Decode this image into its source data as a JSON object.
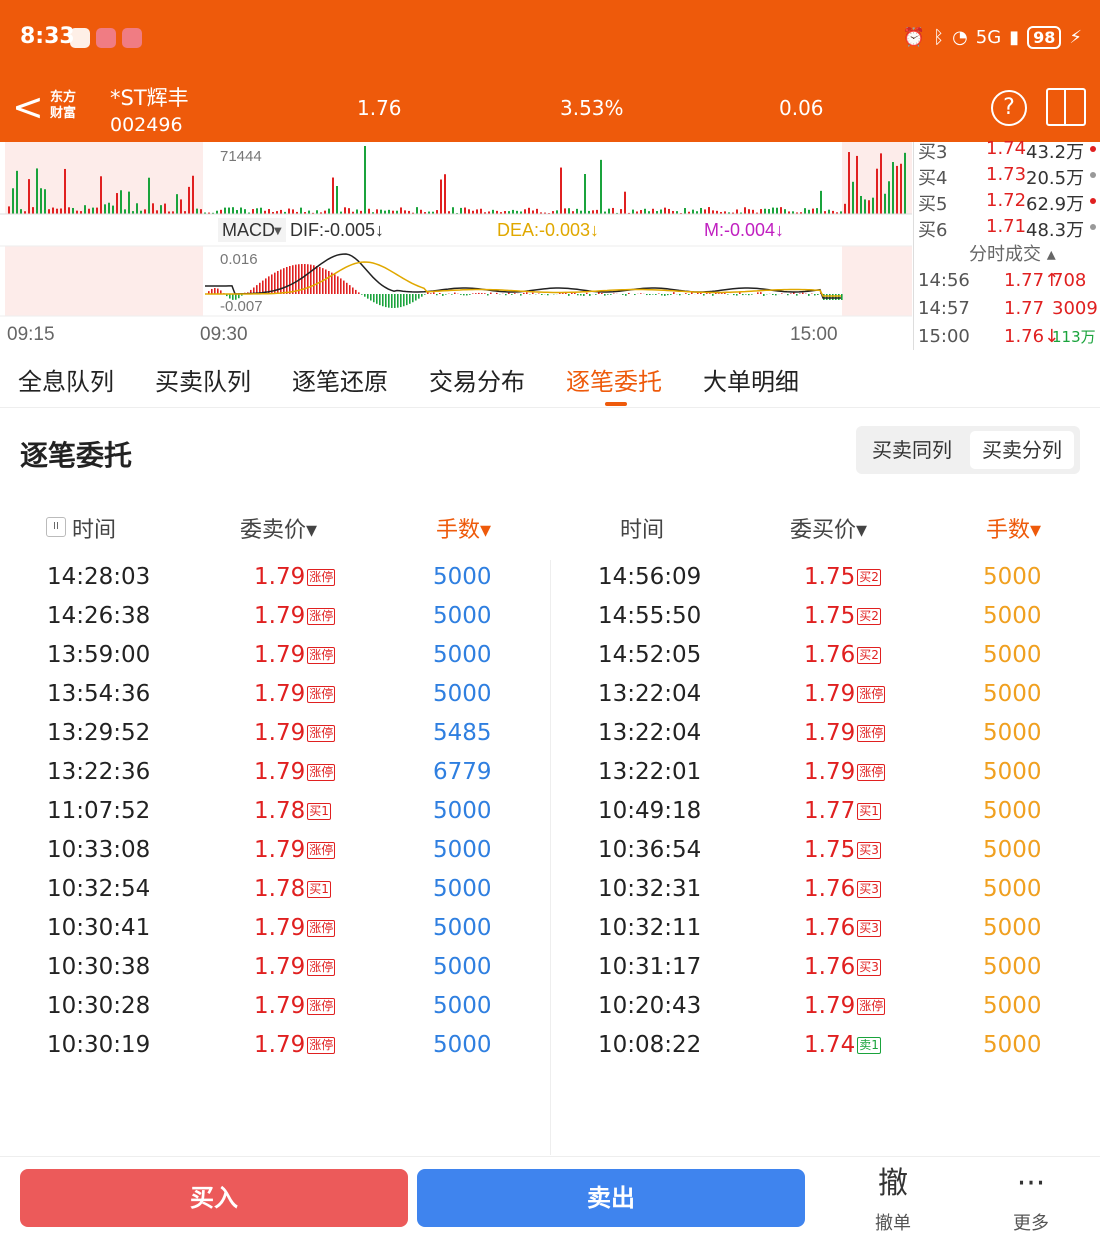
{
  "status": {
    "time": "8:33",
    "battery": "98",
    "signal": "5G"
  },
  "header": {
    "back": "<",
    "logo_line1": "东方",
    "logo_line2": "财富",
    "name": "*ST辉丰",
    "code": "002496",
    "price": "1.76",
    "pct": "3.53%",
    "change": "0.06",
    "help": "?"
  },
  "chart": {
    "volume_label": "71444",
    "macd_label": "MACD",
    "dif": "DIF:-0.005↓",
    "dea": "DEA:-0.003↓",
    "m": "M:-0.004↓",
    "macd_top": "0.016",
    "macd_bottom": "-0.007",
    "time_start": "09:15",
    "time_open": "09:30",
    "time_end": "15:00"
  },
  "orderbook": {
    "bids": [
      {
        "label": "买3",
        "price": "1.74",
        "vol": "43.2万",
        "dot": "#e02020"
      },
      {
        "label": "买4",
        "price": "1.73",
        "vol": "20.5万",
        "dot": "#999999"
      },
      {
        "label": "买5",
        "price": "1.72",
        "vol": "62.9万",
        "dot": "#e02020"
      },
      {
        "label": "买6",
        "price": "1.71",
        "vol": "48.3万",
        "dot": "#999999"
      }
    ],
    "trades_title": "分时成交",
    "trades": [
      {
        "time": "14:56",
        "price": "1.77↑",
        "vol": "708",
        "vol_color": "#e02020"
      },
      {
        "time": "14:57",
        "price": "1.77",
        "vol": "3009",
        "vol_color": "#e02020"
      },
      {
        "time": "15:00",
        "price": "1.76↓",
        "vol": "113万",
        "vol_color": "#1aa33c"
      }
    ]
  },
  "tabs": [
    {
      "label": "全息队列"
    },
    {
      "label": "买卖队列"
    },
    {
      "label": "逐笔还原"
    },
    {
      "label": "交易分布"
    },
    {
      "label": "逐笔委托"
    },
    {
      "label": "大单明细"
    }
  ],
  "section": {
    "title": "逐笔委托",
    "toggle_a": "买卖同列",
    "toggle_b": "买卖分列"
  },
  "columns": {
    "time": "时间",
    "sell_price": "委卖价▾",
    "qty": "手数▾",
    "time2": "时间",
    "buy_price": "委买价▾",
    "qty2": "手数▾"
  },
  "sell_orders": [
    {
      "time": "14:28:03",
      "price": "1.79",
      "tag": "涨停",
      "vol": "5000"
    },
    {
      "time": "14:26:38",
      "price": "1.79",
      "tag": "涨停",
      "vol": "5000"
    },
    {
      "time": "13:59:00",
      "price": "1.79",
      "tag": "涨停",
      "vol": "5000"
    },
    {
      "time": "13:54:36",
      "price": "1.79",
      "tag": "涨停",
      "vol": "5000"
    },
    {
      "time": "13:29:52",
      "price": "1.79",
      "tag": "涨停",
      "vol": "5485"
    },
    {
      "time": "13:22:36",
      "price": "1.79",
      "tag": "涨停",
      "vol": "6779"
    },
    {
      "time": "11:07:52",
      "price": "1.78",
      "tag": "买1",
      "vol": "5000"
    },
    {
      "time": "10:33:08",
      "price": "1.79",
      "tag": "涨停",
      "vol": "5000"
    },
    {
      "time": "10:32:54",
      "price": "1.78",
      "tag": "买1",
      "vol": "5000"
    },
    {
      "time": "10:30:41",
      "price": "1.79",
      "tag": "涨停",
      "vol": "5000"
    },
    {
      "time": "10:30:38",
      "price": "1.79",
      "tag": "涨停",
      "vol": "5000"
    },
    {
      "time": "10:30:28",
      "price": "1.79",
      "tag": "涨停",
      "vol": "5000"
    },
    {
      "time": "10:30:19",
      "price": "1.79",
      "tag": "涨停",
      "vol": "5000"
    }
  ],
  "buy_orders": [
    {
      "time": "14:56:09",
      "price": "1.75",
      "tag": "买2",
      "vol": "5000"
    },
    {
      "time": "14:55:50",
      "price": "1.75",
      "tag": "买2",
      "vol": "5000"
    },
    {
      "time": "14:52:05",
      "price": "1.76",
      "tag": "买2",
      "vol": "5000"
    },
    {
      "time": "13:22:04",
      "price": "1.79",
      "tag": "涨停",
      "vol": "5000"
    },
    {
      "time": "13:22:04",
      "price": "1.79",
      "tag": "涨停",
      "vol": "5000"
    },
    {
      "time": "13:22:01",
      "price": "1.79",
      "tag": "涨停",
      "vol": "5000"
    },
    {
      "time": "10:49:18",
      "price": "1.77",
      "tag": "买1",
      "vol": "5000"
    },
    {
      "time": "10:36:54",
      "price": "1.75",
      "tag": "买3",
      "vol": "5000"
    },
    {
      "time": "10:32:31",
      "price": "1.76",
      "tag": "买3",
      "vol": "5000"
    },
    {
      "time": "10:32:11",
      "price": "1.76",
      "tag": "买3",
      "vol": "5000"
    },
    {
      "time": "10:31:17",
      "price": "1.76",
      "tag": "买3",
      "vol": "5000"
    },
    {
      "time": "10:20:43",
      "price": "1.79",
      "tag": "涨停",
      "vol": "5000"
    },
    {
      "time": "10:08:22",
      "price": "1.74",
      "tag": "卖1",
      "vol": "5000"
    }
  ],
  "bottom": {
    "buy": "买入",
    "sell": "卖出",
    "cancel_icon": "撤",
    "cancel": "撤单",
    "more_icon": "···",
    "more": "更多"
  }
}
